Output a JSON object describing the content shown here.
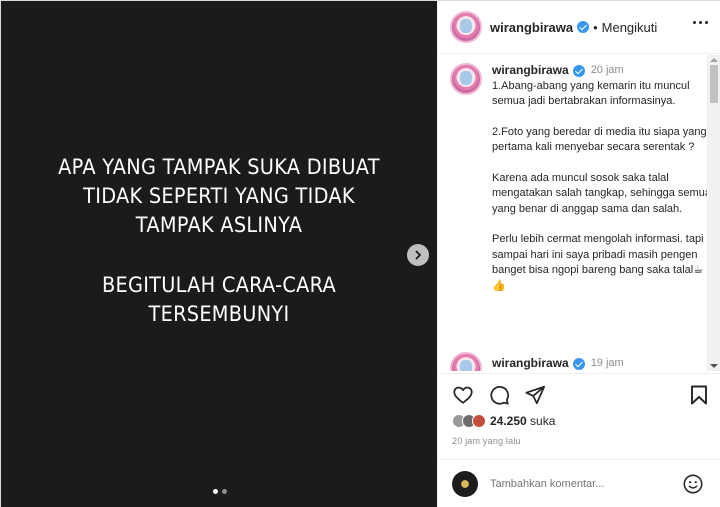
{
  "media": {
    "lines_top": [
      "APA YANG TAMPAK SUKA DIBUAT",
      "TIDAK SEPERTI YANG TIDAK",
      "TAMPAK ASLINYA"
    ],
    "lines_bottom": [
      "BEGITULAH CARA-CARA",
      "TERSEMBUNYI"
    ],
    "background": "#1b1b1b"
  },
  "header": {
    "username": "wirangbirawa",
    "separator": "•",
    "follow_label": "Mengikuti"
  },
  "comments": [
    {
      "username": "wirangbirawa",
      "time": "20 jam",
      "paragraphs": [
        "1.Abang-abang yang kemarin itu muncul semua jadi bertabrakan informasinya.",
        "2.Foto yang beredar di media itu siapa yang pertama kali menyebar secara serentak ?",
        "Karena ada muncul sosok saka talal mengatakan salah tangkap, sehingga semua yang benar di anggap sama dan salah.",
        "Perlu lebih cermat mengolah informasi. tapi sampai hari ini saya pribadi masih pengen banget bisa ngopi bareng bang saka talal☕👍"
      ]
    },
    {
      "username": "wirangbirawa",
      "time": "19 jam",
      "paragraphs": []
    }
  ],
  "actions": {
    "likes_count": "24.250",
    "likes_suffix": "suka",
    "time_ago": "20 jam yang lalu"
  },
  "comment_box": {
    "placeholder": "Tambahkan komentar..."
  },
  "colors": {
    "verified": "#3897f0",
    "muted": "#8e8e8e"
  }
}
